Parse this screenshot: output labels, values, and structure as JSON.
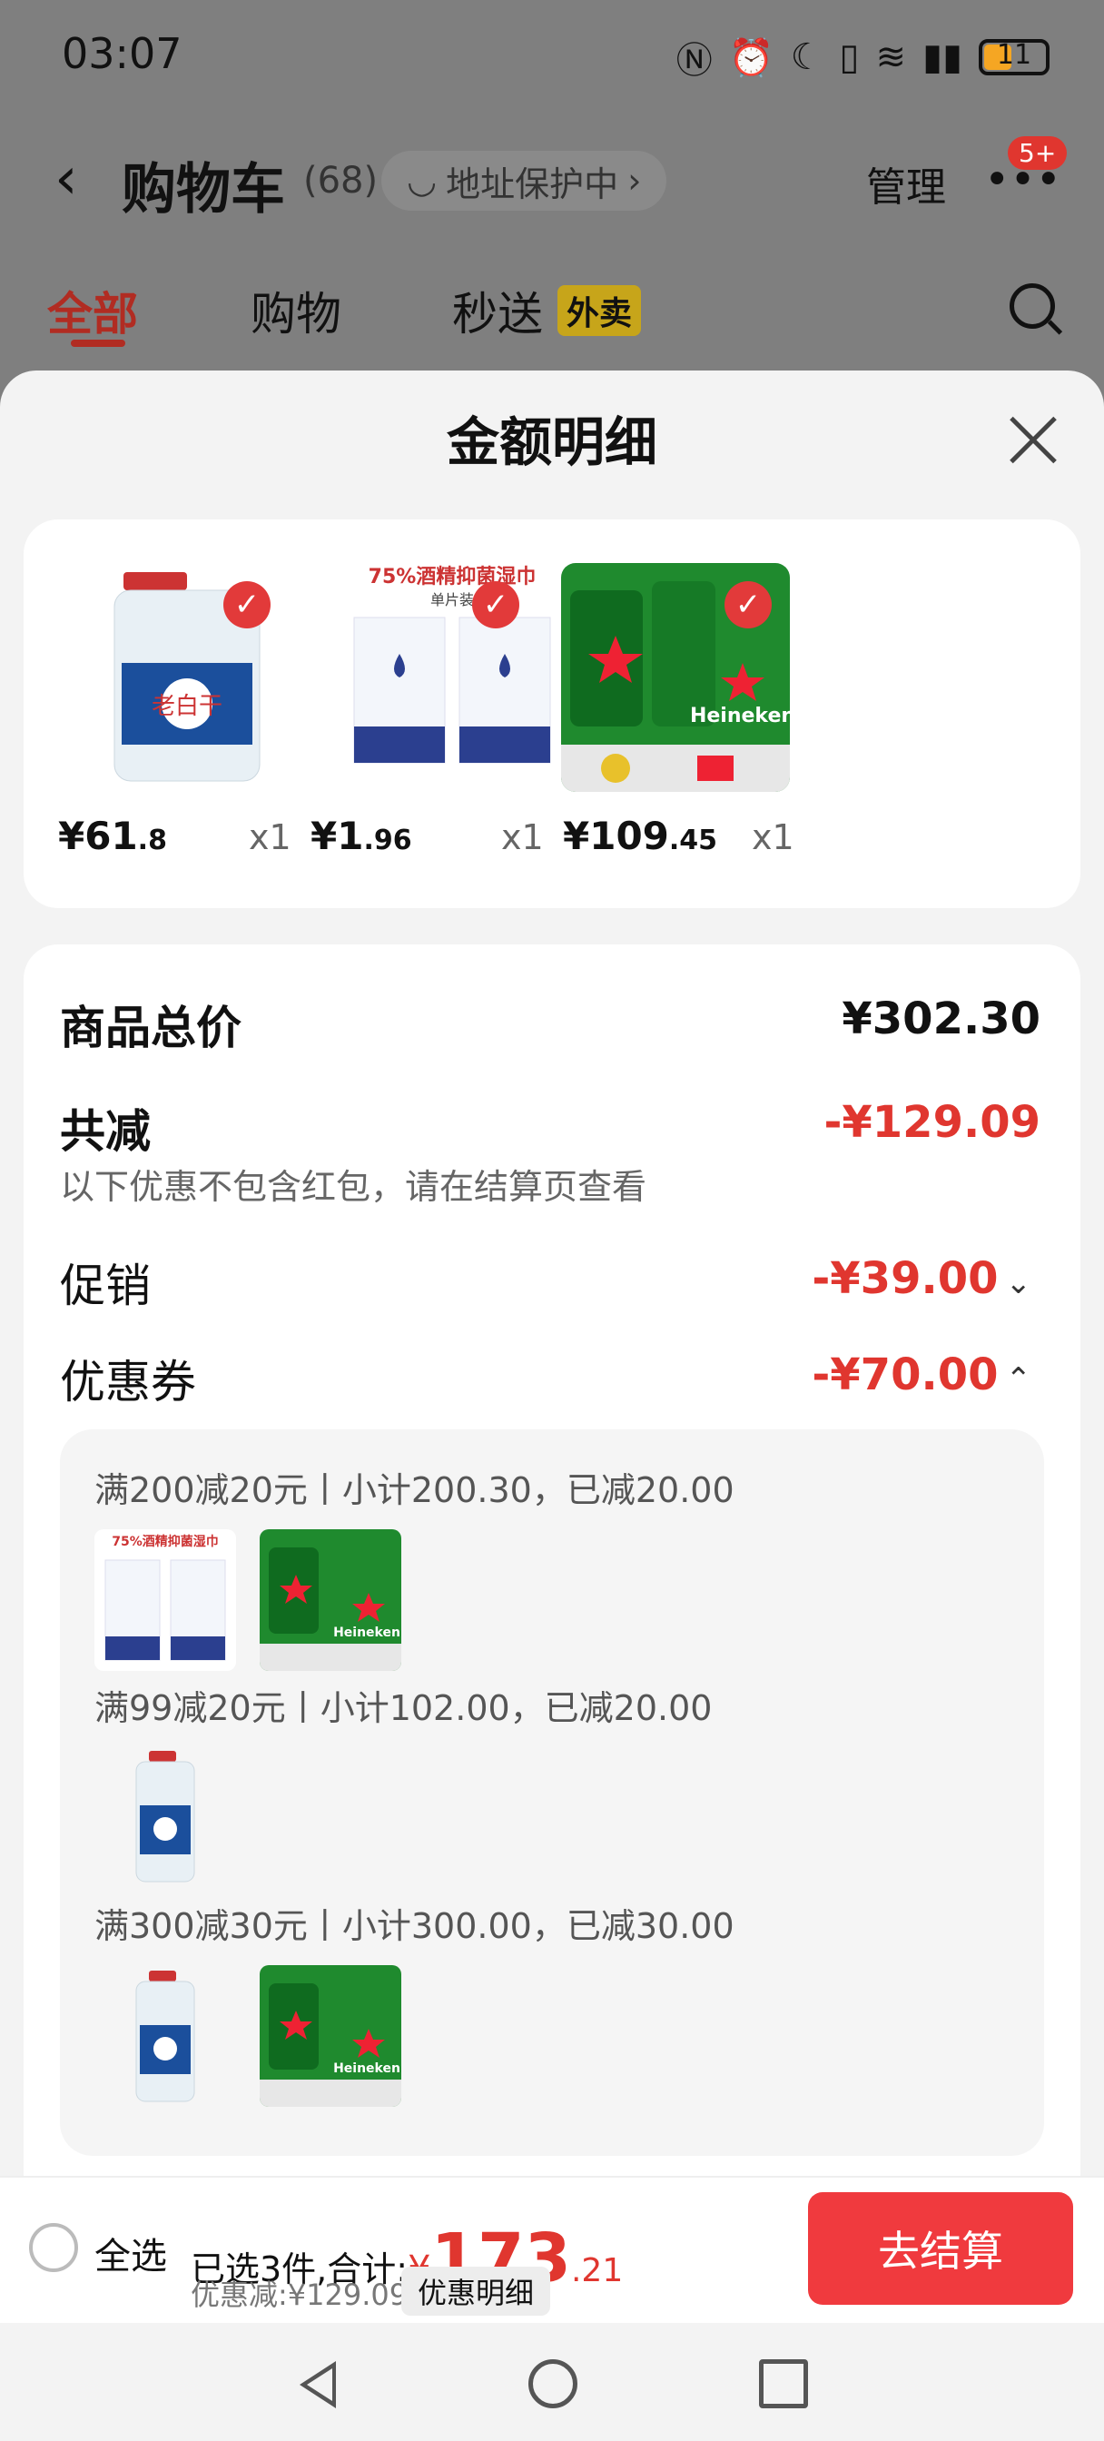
{
  "status_bar": {
    "time": "03:07",
    "battery": "11"
  },
  "header": {
    "title": "购物车",
    "count": "(68)",
    "address_pill": "地址保护中",
    "manage": "管理",
    "badge": "5+"
  },
  "tabs": [
    {
      "label": "全部",
      "active": true
    },
    {
      "label": "购物"
    },
    {
      "label": "秒送"
    }
  ],
  "tab_tag": "外卖",
  "sheet": {
    "title": "金额明细",
    "products": [
      {
        "name": "white-liquor-bottle",
        "price_int": "¥61",
        "price_dec": ".8",
        "qty": "x1"
      },
      {
        "name": "alcohol-wipes",
        "price_int": "¥1",
        "price_dec": ".96",
        "qty": "x1"
      },
      {
        "name": "heineken-beer",
        "price_int": "¥109",
        "price_dec": ".45",
        "qty": "x1"
      }
    ],
    "product_images": {
      "wipes_text": "75%酒精抑菌湿巾",
      "wipes_sub": "单片装",
      "heineken_text": "Heineken",
      "liquor_text": "老白干"
    },
    "summary": {
      "total_label": "商品总价",
      "total_value": "¥302.30",
      "reduce_label": "共减",
      "reduce_value": "-¥129.09",
      "reduce_note": "以下优惠不包含红包，请在结算页查看",
      "promo_label": "促销",
      "promo_value": "-¥39.00",
      "coupon_label": "优惠券",
      "coupon_value": "-¥70.00"
    },
    "coupons": [
      {
        "text": "满200减20元丨小计200.30，已减20.00"
      },
      {
        "text": "满99减20元丨小计102.00，已减20.00"
      },
      {
        "text": "满300减30元丨小计300.00，已减30.00"
      }
    ]
  },
  "bottom_bar": {
    "select_all": "全选",
    "selected": "已选3件,合计:",
    "yen": "¥",
    "total_int": "173",
    "total_dec": ".21",
    "discount": "优惠减:¥129.09",
    "detail_button": "优惠明细",
    "checkout": "去结算"
  },
  "colors": {
    "accent": "#e0362f",
    "checkout": "#f03a3e",
    "beer_green": "#1f8a2e"
  }
}
